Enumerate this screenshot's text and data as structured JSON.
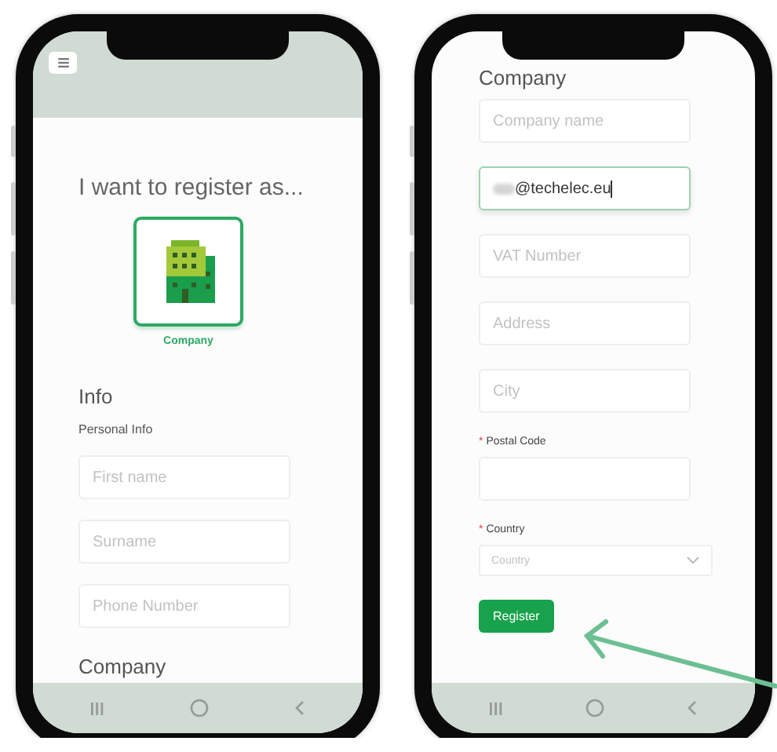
{
  "phones": [
    {
      "kind": "role",
      "header": {
        "menu": true
      },
      "title": "I want to register as...",
      "options": [
        {
          "label": "Company",
          "selected": true
        }
      ],
      "section": "Info",
      "subsection": "Personal Info",
      "fields": [
        {
          "placeholder": "First name"
        },
        {
          "placeholder": "Surname"
        },
        {
          "placeholder": "Phone Number"
        }
      ],
      "next_section": "Company"
    },
    {
      "kind": "company",
      "section": "Company",
      "fields": [
        {
          "kind": "input",
          "placeholder": "Company name",
          "focused": false
        },
        {
          "kind": "input",
          "value": "@techelec.eu",
          "focused": true,
          "redacted_prefix": true
        },
        {
          "kind": "input",
          "placeholder": "VAT Number",
          "focused": false
        },
        {
          "kind": "input",
          "placeholder": "Address",
          "focused": false
        },
        {
          "kind": "input",
          "placeholder": "City",
          "focused": false
        },
        {
          "kind": "input",
          "label": "Postal Code",
          "required_mark": "*",
          "focused": false
        },
        {
          "kind": "select",
          "label": "Country",
          "required_mark": "*",
          "placeholder": "Country",
          "focused": false
        }
      ],
      "button": "Register"
    }
  ],
  "annotation": {
    "arrow": true
  }
}
